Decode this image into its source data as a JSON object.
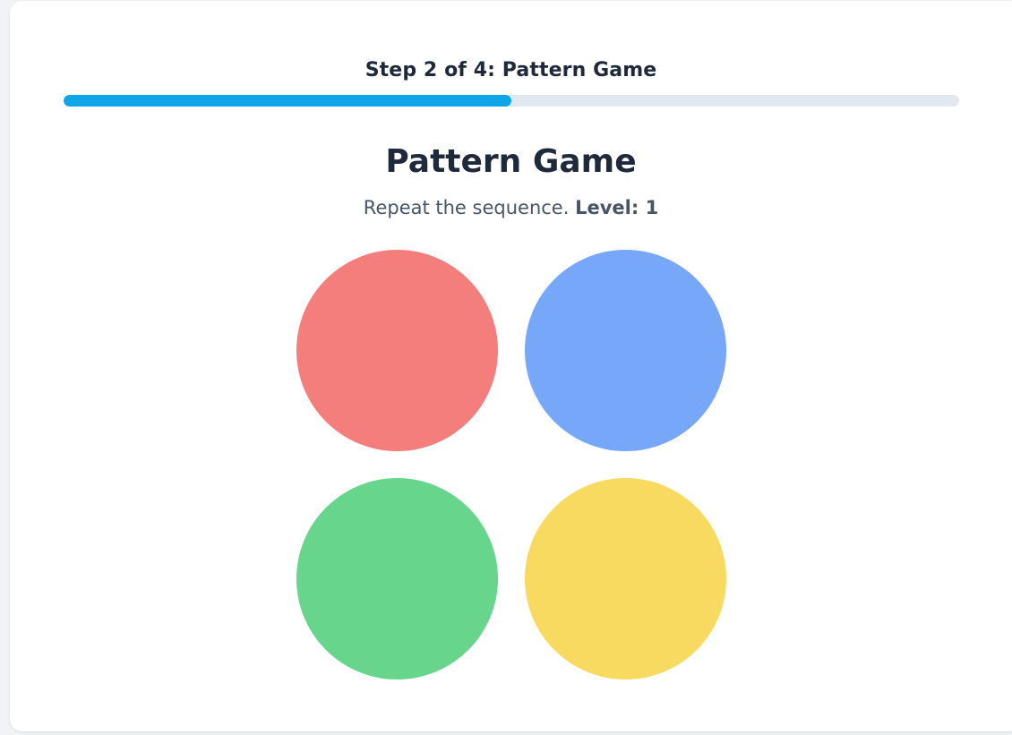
{
  "progress": {
    "step_label": "Step 2 of 4: Pattern Game",
    "current_step": 2,
    "total_steps": 4,
    "fill_fraction": 0.5,
    "track_color": "#e2e8f0",
    "fill_color": "#0ea5e9"
  },
  "game": {
    "title": "Pattern Game",
    "instructions_text": "Repeat the sequence.",
    "level_label": "Level:",
    "level_value": "1"
  },
  "pads": [
    {
      "name": "red-pad",
      "color": "#f37e7c"
    },
    {
      "name": "blue-pad",
      "color": "#77a7f8"
    },
    {
      "name": "green-pad",
      "color": "#67d68c"
    },
    {
      "name": "yellow-pad",
      "color": "#f9da60"
    }
  ]
}
